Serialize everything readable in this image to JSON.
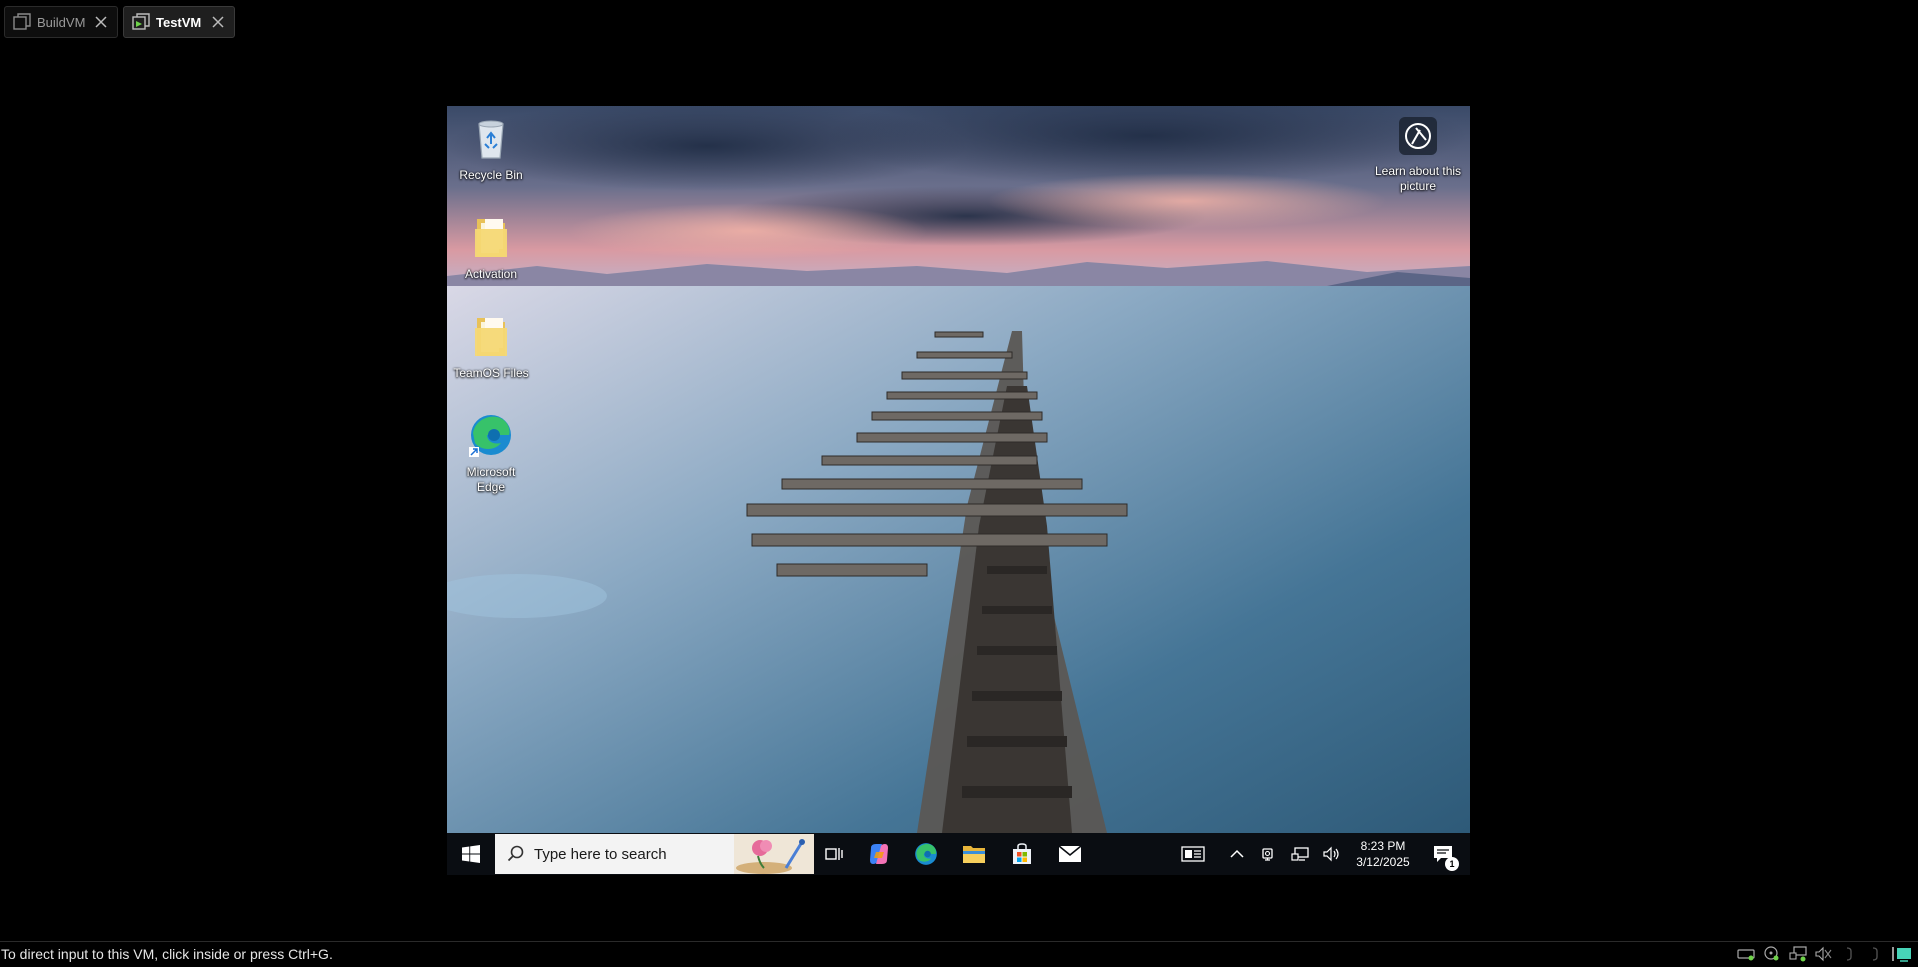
{
  "host_tabs": [
    {
      "label": "BuildVM",
      "active": false
    },
    {
      "label": "TestVM",
      "active": true
    }
  ],
  "desktop": {
    "icons": [
      {
        "label": "Recycle Bin",
        "icon": "recycle-bin-icon"
      },
      {
        "label": "Activation",
        "icon": "folder-icon"
      },
      {
        "label": "TeamOS Files",
        "icon": "folder-icon"
      },
      {
        "label": "Microsoft Edge",
        "icon": "edge-icon"
      }
    ],
    "spotlight": {
      "label": "Learn about this picture",
      "icon": "camera-icon"
    }
  },
  "taskbar": {
    "search_placeholder": "Type here to search",
    "time": "8:23 PM",
    "date": "3/12/2025",
    "notification_count": "1",
    "pinned": [
      "task-view-icon",
      "copilot-icon",
      "edge-icon",
      "file-explorer-icon",
      "store-icon",
      "mail-icon"
    ],
    "tray": [
      "news-icon",
      "chevron-up-icon",
      "meet-icon",
      "network-icon",
      "volume-icon"
    ]
  },
  "statusbar": {
    "message": "To direct input to this VM, click inside or press Ctrl+G."
  },
  "colors": {
    "accent_green": "#6fd34a",
    "taskbar_bg": "#0a0d12",
    "sky_top": "#3f5170",
    "sky_glow": "#e8a7a4",
    "water": "#3d6b88"
  }
}
